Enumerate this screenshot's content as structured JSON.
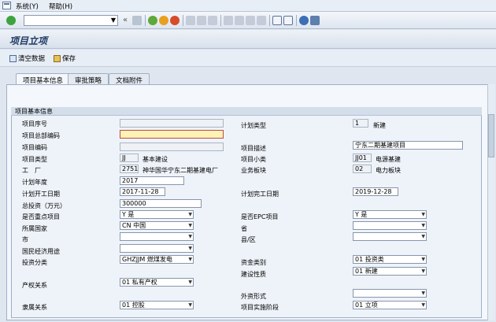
{
  "menu": {
    "system": "系统(Y)",
    "help": "帮助(H)"
  },
  "toolbar": {
    "back": "«"
  },
  "title": "项目立项",
  "app_toolbar": {
    "clear": "清空数据",
    "save": "保存"
  },
  "tabs": [
    "项目基本信息",
    "审批策略",
    "文档附件"
  ],
  "group_title": "项目基本信息",
  "left_fields": [
    {
      "label": "项目序号",
      "value": "",
      "desc": ""
    },
    {
      "label": "项目总部编码",
      "value": "",
      "desc": ""
    },
    {
      "label": "项目编码",
      "value": "",
      "desc": ""
    },
    {
      "label": "项目类型",
      "value": "JJ",
      "desc": "基本建设"
    },
    {
      "label": "工　厂",
      "value": "2751",
      "desc": "神华国华宁东二期基建电厂"
    },
    {
      "label": "计划年度",
      "value": "2017",
      "desc": ""
    },
    {
      "label": "计划开工日期",
      "value": "2017-11-28",
      "desc": ""
    },
    {
      "label": "总投资（万元）",
      "value": "300000",
      "desc": ""
    },
    {
      "label": "是否重点项目",
      "value": "Y 是",
      "desc": ""
    },
    {
      "label": "所属国家",
      "value": "CN 中国",
      "desc": ""
    },
    {
      "label": "市",
      "value": "",
      "desc": ""
    },
    {
      "label": "国民经济用途",
      "value": "",
      "desc": ""
    },
    {
      "label": "投资分类",
      "value": "GHZJJM 燃煤发电",
      "desc": ""
    },
    {
      "label": "产权关系",
      "value": "01 私有产权",
      "desc": ""
    },
    {
      "label": "隶属关系",
      "value": "01 控股",
      "desc": ""
    }
  ],
  "right_fields": [
    {
      "label": "计划类型",
      "value": "1",
      "desc": "新建"
    },
    {
      "label": "项目描述",
      "value": "宁东二期基建项目",
      "desc": ""
    },
    {
      "label": "项目小类",
      "value": "JJ01",
      "desc": "电源基建"
    },
    {
      "label": "业务板块",
      "value": "02",
      "desc": "电力板块"
    },
    {
      "label": "计划完工日期",
      "value": "2019-12-28",
      "desc": ""
    },
    {
      "label": "是否EPC项目",
      "value": "Y 是",
      "desc": ""
    },
    {
      "label": "省",
      "value": "",
      "desc": ""
    },
    {
      "label": "县/区",
      "value": "",
      "desc": ""
    },
    {
      "label": "资金类别",
      "value": "01 投资类",
      "desc": ""
    },
    {
      "label": "建设性质",
      "value": "01 新建",
      "desc": ""
    },
    {
      "label": "外资形式",
      "value": "",
      "desc": ""
    },
    {
      "label": "项目实施阶段",
      "value": "01 立项",
      "desc": ""
    }
  ],
  "colors": {
    "title": "#1f3a64",
    "required_bg": "#fdf3b5"
  }
}
